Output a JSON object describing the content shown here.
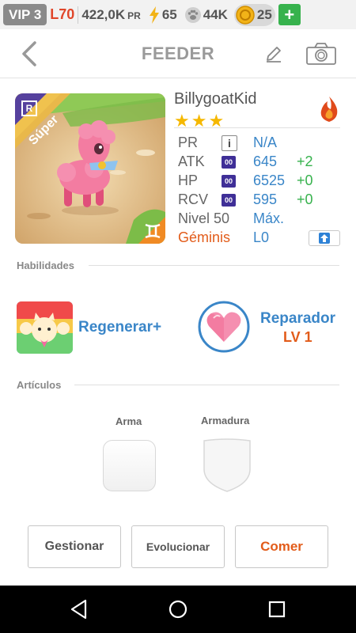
{
  "status_bar": {
    "vip": "VIP 3",
    "level": "L70",
    "power": "422,0K",
    "power_unit": "PR",
    "energy": "65",
    "paws": "44K",
    "coins": "25",
    "add_label": "+"
  },
  "header": {
    "title": "FEEDER"
  },
  "pet": {
    "rarity_badge": "R",
    "rank_label": "Súper",
    "name": "BillygoatKid",
    "stars": "★★★",
    "stats": {
      "pr_label": "PR",
      "pr_value": "N/A",
      "atk_label": "ATK",
      "atk_value": "645",
      "atk_bonus": "+2",
      "hp_label": "HP",
      "hp_value": "6525",
      "hp_bonus": "+0",
      "rcv_label": "RCV",
      "rcv_value": "595",
      "rcv_bonus": "+0",
      "level_label": "Nivel 50",
      "level_value": "Máx.",
      "gem_label": "Géminis",
      "gem_value": "L0",
      "gem_badge": "00"
    },
    "info_icon": "i"
  },
  "skills": {
    "title": "Habilidades",
    "skill1": "Regenerar+",
    "skill2": "Reparador",
    "skill2_level": "LV 1"
  },
  "items": {
    "title": "Artículos",
    "weapon_label": "Arma",
    "armor_label": "Armadura"
  },
  "actions": {
    "manage": "Gestionar",
    "evolve": "Evolucionar",
    "eat": "Comer"
  },
  "colors": {
    "accent_blue": "#3a86c8",
    "accent_orange": "#e25c1a",
    "green": "#37b24d"
  }
}
